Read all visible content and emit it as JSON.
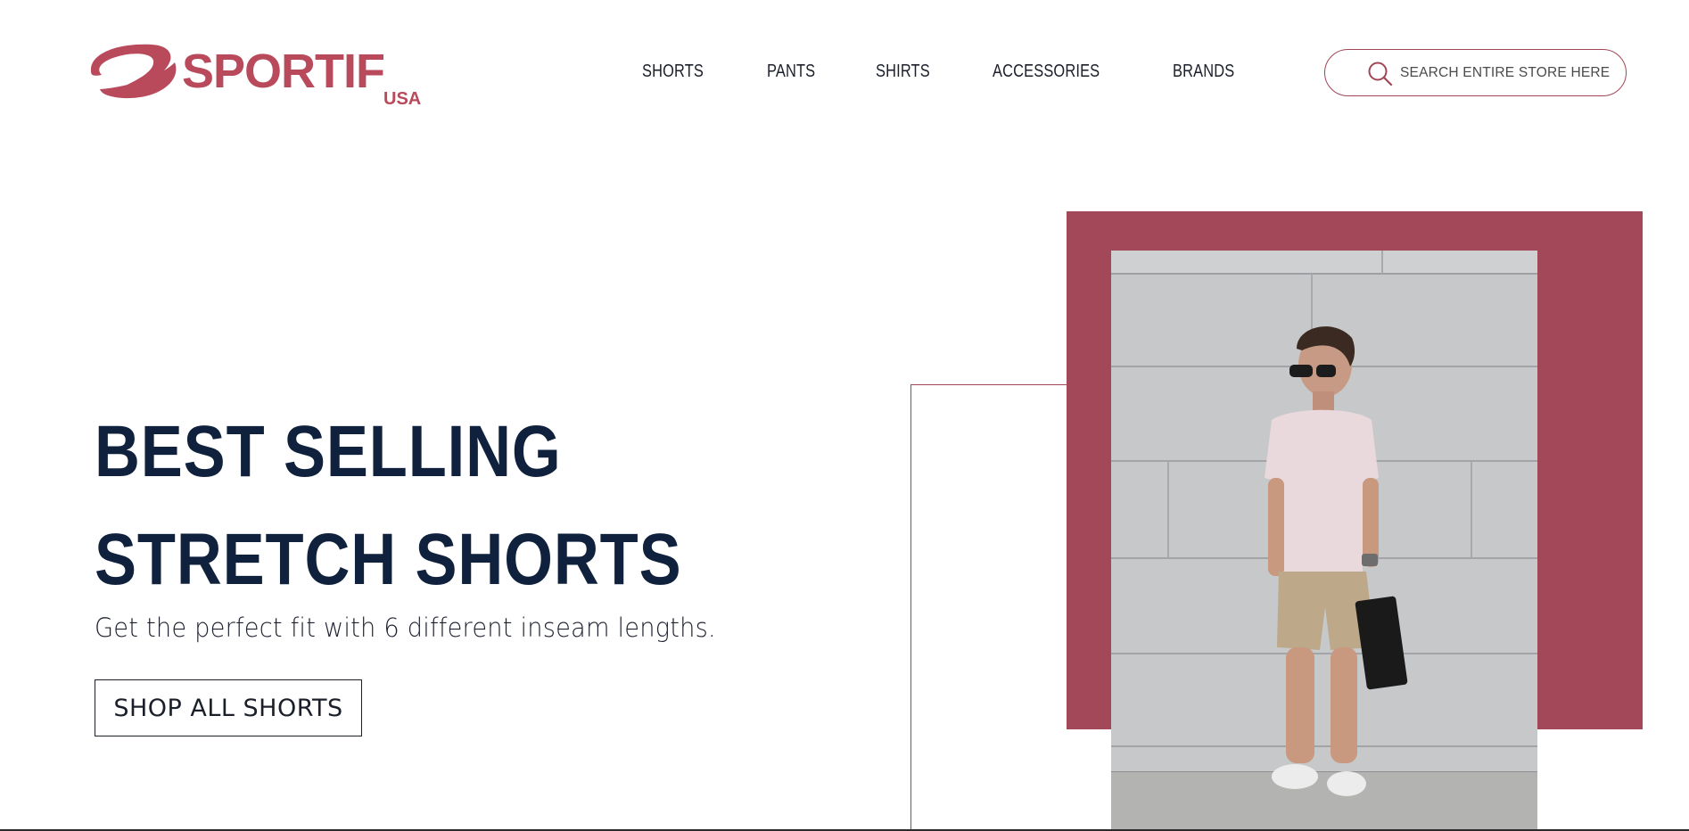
{
  "brand": {
    "name": "SPORTIF",
    "sub": "USA",
    "accent_color": "#a24858",
    "dark_color": "#0f213d"
  },
  "nav": {
    "items": [
      {
        "label": "SHORTS"
      },
      {
        "label": "PANTS"
      },
      {
        "label": "SHIRTS"
      },
      {
        "label": "ACCESSORIES"
      },
      {
        "label": "BRANDS"
      }
    ]
  },
  "search": {
    "placeholder": "SEARCH ENTIRE STORE HERE",
    "icon": "search-icon"
  },
  "hero": {
    "title_line1": "BEST SELLING",
    "title_line2": "STRETCH SHORTS",
    "subtitle": "Get the perfect fit with 6 different inseam lengths.",
    "cta_label": "SHOP ALL SHORTS"
  }
}
